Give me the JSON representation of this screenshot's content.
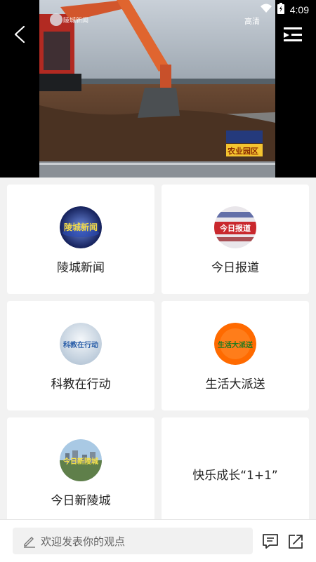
{
  "status_bar": {
    "time": "4:09"
  },
  "video": {
    "quality": "高清",
    "channel_logo_text": "陵城新闻",
    "caption_text": "农业园区"
  },
  "programs": [
    {
      "label": "陵城新闻",
      "logo_text": "陵城新闻",
      "logo_colors": [
        "#1e2f7a",
        "#e9d54c"
      ]
    },
    {
      "label": "今日报道",
      "logo_text": "今日报道",
      "logo_colors": [
        "#c9282d",
        "#ffffff"
      ]
    },
    {
      "label": "科教在行动",
      "logo_text": "科教在行动",
      "logo_colors": [
        "#dbe6ef",
        "#2a5ea8"
      ]
    },
    {
      "label": "生活大派送",
      "logo_text": "生活大派送",
      "logo_colors": [
        "#ff6a00",
        "#2e8b2e"
      ]
    },
    {
      "label": "今日新陵城",
      "logo_text": "今日新陵城",
      "logo_colors": [
        "#8fb8d8",
        "#3c6e2f"
      ]
    },
    {
      "label": "快乐成长“1+1”"
    }
  ],
  "bottom_bar": {
    "comment_placeholder": "欢迎发表你的观点"
  }
}
